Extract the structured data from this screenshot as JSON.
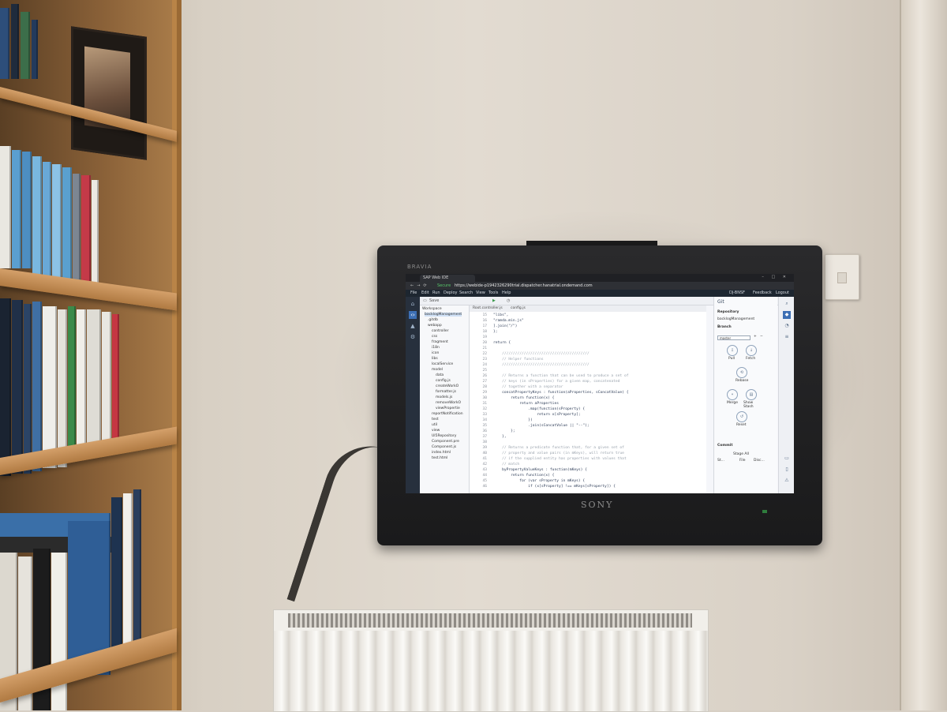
{
  "tv": {
    "brand_top": "BRAVIA",
    "brand_bottom": "SONY"
  },
  "browser": {
    "tab_title": "SAP Web IDE",
    "secure_label": "Secure",
    "url": "https://webide-p1942326290trial.dispatcher.hanatrial.ondemand.com"
  },
  "ide": {
    "menu": [
      "File",
      "Edit",
      "Run",
      "Deploy",
      "Search",
      "View",
      "Tools",
      "Help"
    ],
    "user": "DJ-BNSF",
    "feedback": "Feedback",
    "logout": "Logout",
    "toolbar_save": "Save",
    "editor_tabs": [
      "Root.controller.js",
      "config.js"
    ],
    "tree": [
      "Workspace",
      "backlogManagement",
      ".gitdb",
      "webapp",
      "controller",
      "css",
      "fragment",
      "i18n",
      "icon",
      "libs",
      "localService",
      "model",
      "data",
      "config.js",
      "createWorkO",
      "formatter.js",
      "models.js",
      "removeWorkO",
      "viewPropertie",
      "reportNotification",
      "test",
      "util",
      "view",
      "UI5Repository",
      "Component.pre",
      "Component.js",
      "index.html",
      "test.html"
    ],
    "code": [
      {
        "n": "15",
        "t": "\"libs\","
      },
      {
        "n": "16",
        "t": "\"ramda.min.js\""
      },
      {
        "n": "17",
        "t": "].join(\"/\")"
      },
      {
        "n": "18",
        "t": "};"
      },
      {
        "n": "19",
        "t": ""
      },
      {
        "n": "20",
        "t": "return {"
      },
      {
        "n": "21",
        "t": ""
      },
      {
        "n": "22",
        "t": "    ////////////////////////////////////////",
        "c": true
      },
      {
        "n": "23",
        "t": "    // Helper functions",
        "c": true
      },
      {
        "n": "24",
        "t": "    ////////////////////////////////////////",
        "c": true
      },
      {
        "n": "25",
        "t": ""
      },
      {
        "n": "26",
        "t": "    // Returns a function that can be used to produce a set of",
        "c": true
      },
      {
        "n": "27",
        "t": "    // keys (in sProperties) for a given map, concatenated",
        "c": true
      },
      {
        "n": "28",
        "t": "    // together with a separator",
        "c": true
      },
      {
        "n": "29",
        "t": "    concatPropertyKeys : function(aProperties, sConcatValue) {"
      },
      {
        "n": "30",
        "t": "        return function(x) {"
      },
      {
        "n": "31",
        "t": "            return aProperties"
      },
      {
        "n": "32",
        "t": "                .map(function(sProperty) {"
      },
      {
        "n": "33",
        "t": "                    return x[sProperty];"
      },
      {
        "n": "34",
        "t": "                })"
      },
      {
        "n": "35",
        "t": "                .join(sConcatValue || \"--\");"
      },
      {
        "n": "36",
        "t": "        };"
      },
      {
        "n": "37",
        "t": "    },"
      },
      {
        "n": "38",
        "t": ""
      },
      {
        "n": "39",
        "t": "    // Returns a predicate function that, for a given set of",
        "c": true
      },
      {
        "n": "40",
        "t": "    // property and value pairs (in mKeys), will return true",
        "c": true
      },
      {
        "n": "41",
        "t": "    // if the supplied entity has properties with values that",
        "c": true
      },
      {
        "n": "42",
        "t": "    // match",
        "c": true
      },
      {
        "n": "43",
        "t": "    byPropertyValueKeys : function(mKeys) {"
      },
      {
        "n": "44",
        "t": "        return function(x) {"
      },
      {
        "n": "45",
        "t": "            for (var sProperty in mKeys) {"
      },
      {
        "n": "46",
        "t": "                if (x[sProperty] !== mKeys[sProperty]) {"
      }
    ],
    "git": {
      "title": "Git",
      "repository_label": "Repository",
      "repository_value": "backlogManagement",
      "branch_label": "Branch",
      "branch_value": "master",
      "pull": "Pull",
      "fetch": "Fetch",
      "rebase": "Rebase",
      "merge": "Merge",
      "stash": "Show Stash",
      "reset": "Reset",
      "commit_label": "Commit",
      "stage_all": "Stage All",
      "col_status": "St...",
      "col_file": "File",
      "col_discard": "Disc..."
    }
  }
}
